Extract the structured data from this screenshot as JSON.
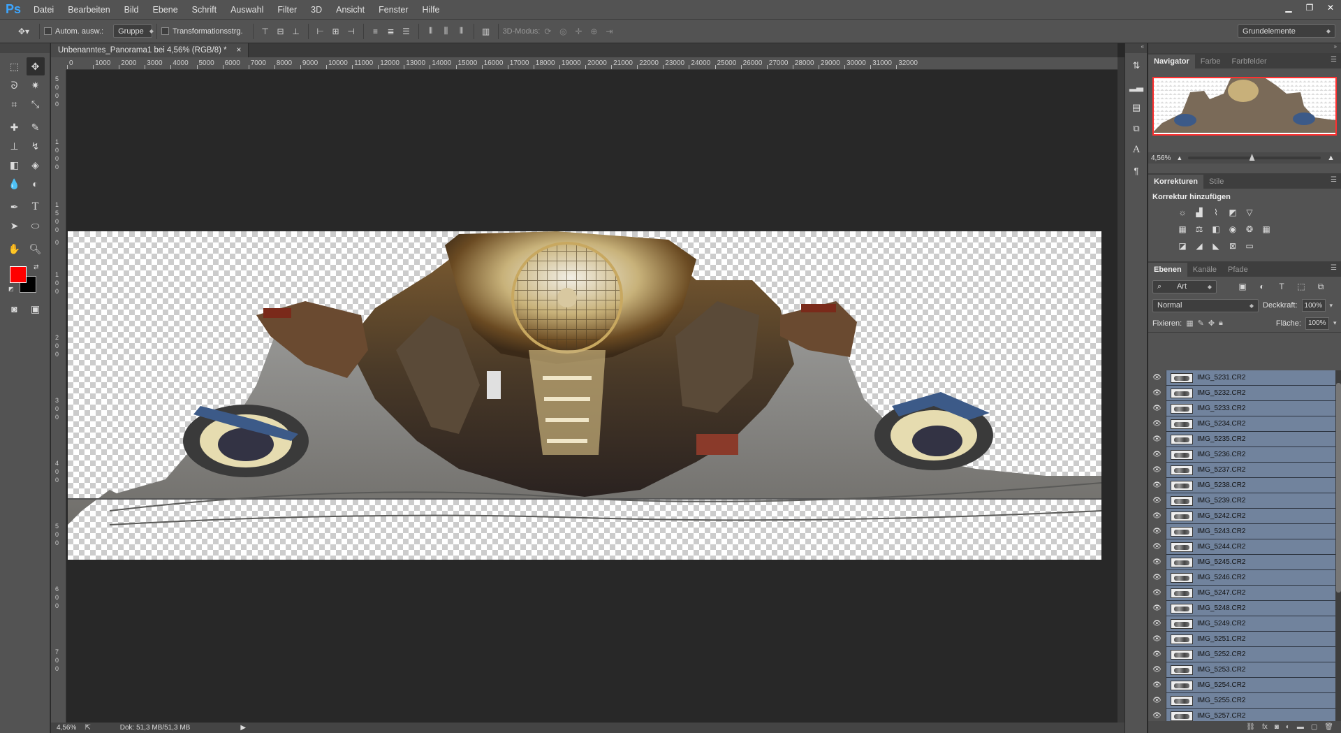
{
  "app": {
    "logo": "Ps"
  },
  "menu": [
    "Datei",
    "Bearbeiten",
    "Bild",
    "Ebene",
    "Schrift",
    "Auswahl",
    "Filter",
    "3D",
    "Ansicht",
    "Fenster",
    "Hilfe"
  ],
  "options": {
    "auto_select_label": "Autom. ausw.:",
    "auto_select_target": "Gruppe",
    "transform_label": "Transformationsstrg.",
    "mode3d_label": "3D-Modus:",
    "workspace": "Grundelemente"
  },
  "document": {
    "tab_title": "Unbenanntes_Panorama1 bei 4,56% (RGB/8) *",
    "close": "×"
  },
  "ruler_h": [
    "0",
    "1000",
    "2000",
    "3000",
    "4000",
    "5000",
    "6000",
    "7000",
    "8000",
    "9000",
    "10000",
    "11000",
    "12000",
    "13000",
    "14000",
    "15000",
    "16000",
    "17000",
    "18000",
    "19000",
    "20000",
    "21000",
    "22000",
    "23000",
    "24000",
    "25000",
    "26000",
    "27000",
    "28000",
    "29000",
    "30000",
    "31000",
    "32000"
  ],
  "status": {
    "zoom": "4,56%",
    "doc": "Dok: 51,3 MB/51,3 MB"
  },
  "navigator": {
    "tabs": [
      "Navigator",
      "Farbe",
      "Farbfelder"
    ],
    "zoom": "4,56%"
  },
  "adjustments": {
    "tabs": [
      "Korrekturen",
      "Stile"
    ],
    "title": "Korrektur hinzufügen"
  },
  "layers_panel": {
    "tabs": [
      "Ebenen",
      "Kanäle",
      "Pfade"
    ],
    "filter": "Art",
    "blend_mode": "Normal",
    "opacity_label": "Deckkraft:",
    "opacity": "100%",
    "lock_label": "Fixieren:",
    "fill_label": "Fläche:",
    "fill": "100%",
    "layers": [
      "IMG_5231.CR2",
      "IMG_5232.CR2",
      "IMG_5233.CR2",
      "IMG_5234.CR2",
      "IMG_5235.CR2",
      "IMG_5236.CR2",
      "IMG_5237.CR2",
      "IMG_5238.CR2",
      "IMG_5239.CR2",
      "IMG_5242.CR2",
      "IMG_5243.CR2",
      "IMG_5244.CR2",
      "IMG_5245.CR2",
      "IMG_5246.CR2",
      "IMG_5247.CR2",
      "IMG_5248.CR2",
      "IMG_5249.CR2",
      "IMG_5251.CR2",
      "IMG_5252.CR2",
      "IMG_5253.CR2",
      "IMG_5254.CR2",
      "IMG_5255.CR2",
      "IMG_5257.CR2"
    ]
  },
  "colors": {
    "foreground": "#ff0000",
    "background": "#000000",
    "selected_layer": "#71839d",
    "accent": "#3da6ff"
  }
}
